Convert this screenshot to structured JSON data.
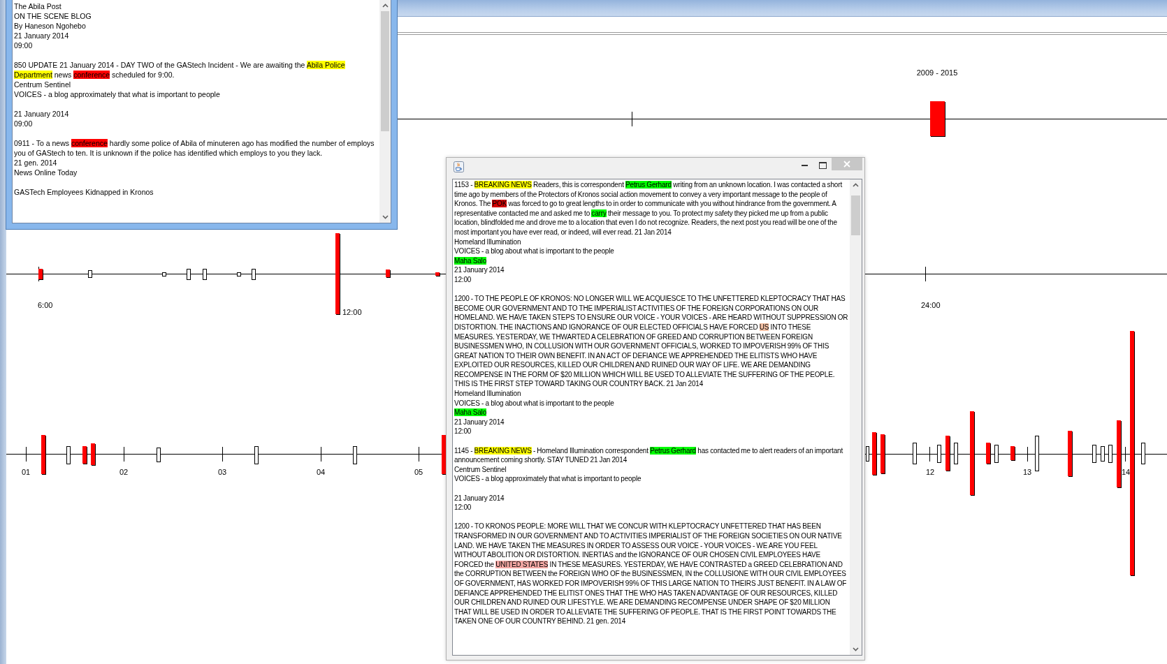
{
  "period_timeline": {
    "label": "2009 - 2015"
  },
  "hour_timeline": {
    "tick_labels": [
      "6:00",
      "12:00",
      "24:00"
    ]
  },
  "day_timeline": {
    "tick_labels": [
      "01",
      "02",
      "03",
      "04",
      "05",
      "12",
      "13",
      "14"
    ]
  },
  "article_popup": {
    "blocks": [
      {
        "lines": [
          "The Abila Post",
          "ON THE SCENE BLOG",
          "By Haneson Ngohebo",
          "21 January 2014",
          "09:00"
        ]
      },
      {
        "lines": [
          [
            "850 UPDATE 21 January 2014 - DAY TWO of the GAStech Incident - We are awaiting the ",
            {
              "text": "Abila Police Department",
              "color": "#ffff00"
            },
            " news ",
            {
              "text": "conference",
              "color": "#ff0000"
            },
            " scheduled for 9:00."
          ],
          "Centrum Sentinel",
          "VOICES - a blog approximately that what is important to people"
        ]
      },
      {
        "lines": [
          "21 January 2014",
          "09:00"
        ]
      },
      {
        "lines": [
          [
            "0911 - To a news ",
            {
              "text": "conference",
              "color": "#ff0000"
            },
            " hardly some police of Abila of minuteren ago has modified the number of employs you of GAStech to ten. It is unknown if the police has identified which employs to you they lack."
          ],
          "21 gen. 2014",
          "News Online Today"
        ]
      },
      {
        "lines": [
          "GASTech Employees Kidnapped in Kronos"
        ]
      }
    ]
  },
  "article_dialog": {
    "blocks": [
      {
        "lines": [
          [
            "1153 - ",
            {
              "text": "BREAKING NEWS",
              "color": "#ffff00"
            },
            " Readers, this is correspondent ",
            {
              "text": "Petrus Gerhard",
              "color": "#00ff00"
            },
            " writing from an unknown location. I was contacted a short time ago by members of the Protectors of Kronos social action movement to convey a very important message to the people of Kronos. The ",
            {
              "text": "POK",
              "color": "#d40000"
            },
            " was forced to go to great lengths to in order to communicate with you without hindrance from the government. A representative contacted me and asked me to ",
            {
              "text": "carry",
              "color": "#00ff00"
            },
            " their message to you. To protect my safety they picked me up from a public location, blindfolded me and drove me to a location that even I do not recognize. Readers, the next post you read will be one of the most important you have ever read, or indeed, will ever read. 21 Jan 2014"
          ],
          "Homeland Illumination",
          "VOICES - a blog about what is important to the people",
          [
            {
              "text": "Maha Salo",
              "color": "#00ff00"
            }
          ],
          "21 January 2014",
          "12:00"
        ]
      },
      {
        "lines": [
          [
            "1200 - TO THE PEOPLE OF KRONOS: NO LONGER WILL WE ACQUIESCE TO THE UNFETTERED KLEPTOCRACY THAT HAS BECOME OUR GOVERNMENT AND TO THE IMPERIALIST ACTIVITIES OF THE FOREIGN CORPORATIONS ON OUR HOMELAND. WE HAVE TAKEN STEPS TO ENSURE OUR VOICE - YOUR VOICES - ARE HEARD WITHOUT SUPPRESSION OR DISTORTION. THE INACTIONS AND IGNORANCE OF OUR ELECTED OFFICIALS HAVE FORCED ",
            {
              "text": "US",
              "color": "#f4c0a4"
            },
            " INTO THESE MEASURES. YESTERDAY, WE THWARTED A CELEBRATION OF GREED AND CORRUPTION BETWEEN FOREIGN BUSINESSMEN WHO, IN COLLUSION WITH OUR GOVERNMENT OFFICIALS, WORKED TO IMPOVERISH 99% OF THIS GREAT NATION TO THEIR OWN BENEFIT. IN AN ACT OF DEFIANCE WE APPREHENDED THE ELITISTS WHO HAVE EXPLOITED OUR RESOURCES, KILLED OUR CHILDREN AND RUINED OUR WAY OF LIFE. WE ARE DEMANDING RECOMPENSE IN THE FORM OF $20 MILLION WHICH WILL BE USED TO ALLEVIATE THE SUFFERING OF THE PEOPLE. THIS IS THE FIRST STEP TOWARD TAKING OUR COUNTRY BACK. 21 Jan 2014"
          ],
          "Homeland Illumination",
          "VOICES - a blog about what is important to the people",
          [
            {
              "text": "Maha Salo",
              "color": "#00ff00"
            }
          ],
          "21 January 2014",
          "12:00"
        ]
      },
      {
        "lines": [
          [
            "1145 - ",
            {
              "text": "BREAKING NEWS",
              "color": "#ffff00"
            },
            " - Homeland Illumination correspondent ",
            {
              "text": "Petrus Gerhard",
              "color": "#00ff00"
            },
            " has contacted me to alert readers of an important announcement coming shortly. STAY TUNED 21 Jan 2014"
          ],
          "Centrum Sentinel",
          "VOICES - a blog approximately that what is important to people"
        ]
      },
      {
        "lines": [
          "21 January 2014",
          "12:00"
        ]
      },
      {
        "lines": [
          [
            "1200 - TO KRONOS PEOPLE: MORE WILL THAT WE CONCUR WITH KLEPTOCRACY UNFETTERED THAT HAS BEEN TRANSFORMED IN OUR GOVERNMENT AND TO ACTIVITIES IMPERIALIST OF THE FOREIGN SOCIETIES ON OUR NATIVE LAND. WE HAVE TAKEN THE MEASURES IN ORDER TO ASSESS OUR VOICE - YOUR VOICES - WE ARE YOU FEEL WITHOUT ABOLITION OR DISTORTION. INERTIAS and the IGNORANCE OF OUR CHOSEN CIVIL EMPLOYEES HAVE FORCED the ",
            {
              "text": "UNITED STATES",
              "color": "#f4a8a4"
            },
            " IN THESE MEASURES. YESTERDAY, WE HAVE CONTRASTED a GREED CELEBRATION AND the CORRUPTION BETWEEN the FOREIGN WHO OF the BUSINESSMEN, IN the COLLUSIONE WITH OUR CIVIL EMPLOYEES OF GOVERNMENT, HAS WORKED FOR IMPOVERISH 99% OF THIS LARGE NATION TO THEIRS JUST BENEFIT. IN A LAW OF DEFIANCE APPREHENDED THE ELITIST ONES THAT THE WHO HAS TAKEN ADVANTAGE OF OUR RESOURCES, KILLED OUR CHILDREN AND RUINED OUR LIFESTYLE. WE ARE DEMANDING RECOMPENSE UNDER SHAPE OF $20 MILLION THAT WILL BE USED IN ORDER TO ALLEVIATE THE SUFFERING OF PEOPLE. THAT IS THE FIRST POINT TOWARDS THE TAKEN ONE OF OUR COUNTRY BEHIND. 21 gen. 2014"
          ]
        ]
      }
    ]
  }
}
